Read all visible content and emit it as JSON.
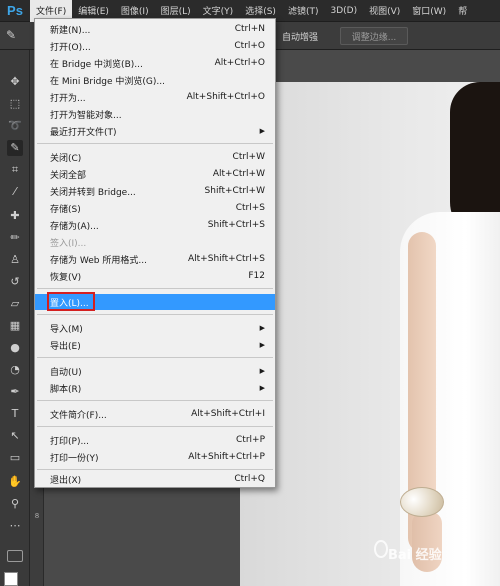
{
  "app": {
    "logo": "Ps"
  },
  "menubar": {
    "items": [
      "文件(F)",
      "编辑(E)",
      "图像(I)",
      "图层(L)",
      "文字(Y)",
      "选择(S)",
      "滤镜(T)",
      "3D(D)",
      "视图(V)",
      "窗口(W)",
      "帮"
    ]
  },
  "options_bar": {
    "auto_enhance": "自动增强",
    "refine_edge": "调整边缘..."
  },
  "ruler": {
    "ticks": [
      "4",
      "5",
      "6",
      "7",
      "8"
    ]
  },
  "watermark": "Bai 经验",
  "file_menu": {
    "items": [
      {
        "label": "新建(N)...",
        "shortcut": "Ctrl+N"
      },
      {
        "label": "打开(O)...",
        "shortcut": "Ctrl+O"
      },
      {
        "label": "在 Bridge 中浏览(B)...",
        "shortcut": "Alt+Ctrl+O"
      },
      {
        "label": "在 Mini Bridge 中浏览(G)...",
        "shortcut": ""
      },
      {
        "label": "打开为...",
        "shortcut": "Alt+Shift+Ctrl+O"
      },
      {
        "label": "打开为智能对象...",
        "shortcut": ""
      },
      {
        "label": "最近打开文件(T)",
        "shortcut": ""
      },
      {
        "label": "关闭(C)",
        "shortcut": "Ctrl+W"
      },
      {
        "label": "关闭全部",
        "shortcut": "Alt+Ctrl+W"
      },
      {
        "label": "关闭并转到 Bridge...",
        "shortcut": "Shift+Ctrl+W"
      },
      {
        "label": "存储(S)",
        "shortcut": "Ctrl+S"
      },
      {
        "label": "存储为(A)...",
        "shortcut": "Shift+Ctrl+S"
      },
      {
        "label": "签入(I)...",
        "shortcut": ""
      },
      {
        "label": "存储为 Web 所用格式...",
        "shortcut": "Alt+Shift+Ctrl+S"
      },
      {
        "label": "恢复(V)",
        "shortcut": "F12"
      },
      {
        "label": "置入(L)...",
        "shortcut": ""
      },
      {
        "label": "导入(M)",
        "shortcut": ""
      },
      {
        "label": "导出(E)",
        "shortcut": ""
      },
      {
        "label": "自动(U)",
        "shortcut": ""
      },
      {
        "label": "脚本(R)",
        "shortcut": ""
      },
      {
        "label": "文件简介(F)...",
        "shortcut": "Alt+Shift+Ctrl+I"
      },
      {
        "label": "打印(P)...",
        "shortcut": "Ctrl+P"
      },
      {
        "label": "打印一份(Y)",
        "shortcut": "Alt+Shift+Ctrl+P"
      },
      {
        "label": "退出(X)",
        "shortcut": "Ctrl+Q"
      }
    ]
  },
  "colors": {
    "highlight": "#3399ff",
    "annotation_box": "#d42020",
    "foreground": "#ffffff",
    "background": "#3d8ed6"
  }
}
